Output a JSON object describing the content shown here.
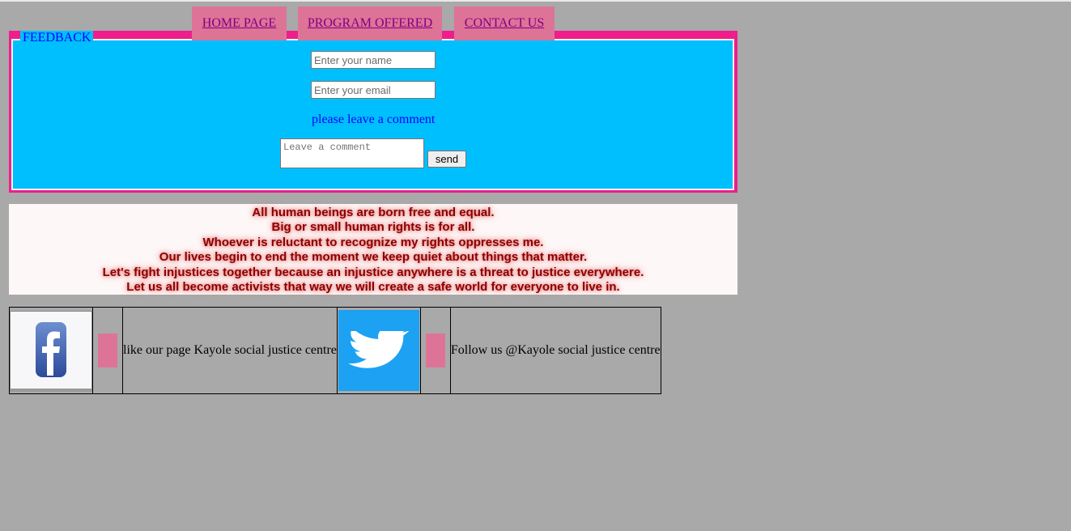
{
  "nav": {
    "home": "HOME PAGE",
    "programs": "PROGRAM OFFERED",
    "contact": "CONTACT US"
  },
  "feedback": {
    "legend": "FEEDBACK",
    "name_placeholder": "Enter your name",
    "email_placeholder": "Enter your email",
    "comment_label": "please leave a comment",
    "comment_placeholder": "Leave a comment",
    "send_label": "send"
  },
  "quotes": [
    "All human beings are born free and equal.",
    "Big or small human rights is for all.",
    "Whoever is reluctant to recognize my rights oppresses me.",
    "Our lives begin to end the moment we keep quiet about things that matter.",
    "Let's fight injustices together because an injustice anywhere is a threat to justice everywhere.",
    "Let us all become activists that way we will create a safe world for everyone to live in."
  ],
  "social": {
    "facebook_icon": "facebook-icon",
    "facebook_text": "like our page Kayole social justice centre",
    "twitter_icon": "twitter-icon",
    "twitter_text": "Follow us @Kayole social justice centre"
  },
  "colors": {
    "background": "#a9a9a9",
    "nav_tab": "#de7398",
    "fieldset_border": "#ef1e8a",
    "fieldset_fill": "#00bfff",
    "quote_text": "#8b0000",
    "twitter_blue": "#1da1f2"
  }
}
